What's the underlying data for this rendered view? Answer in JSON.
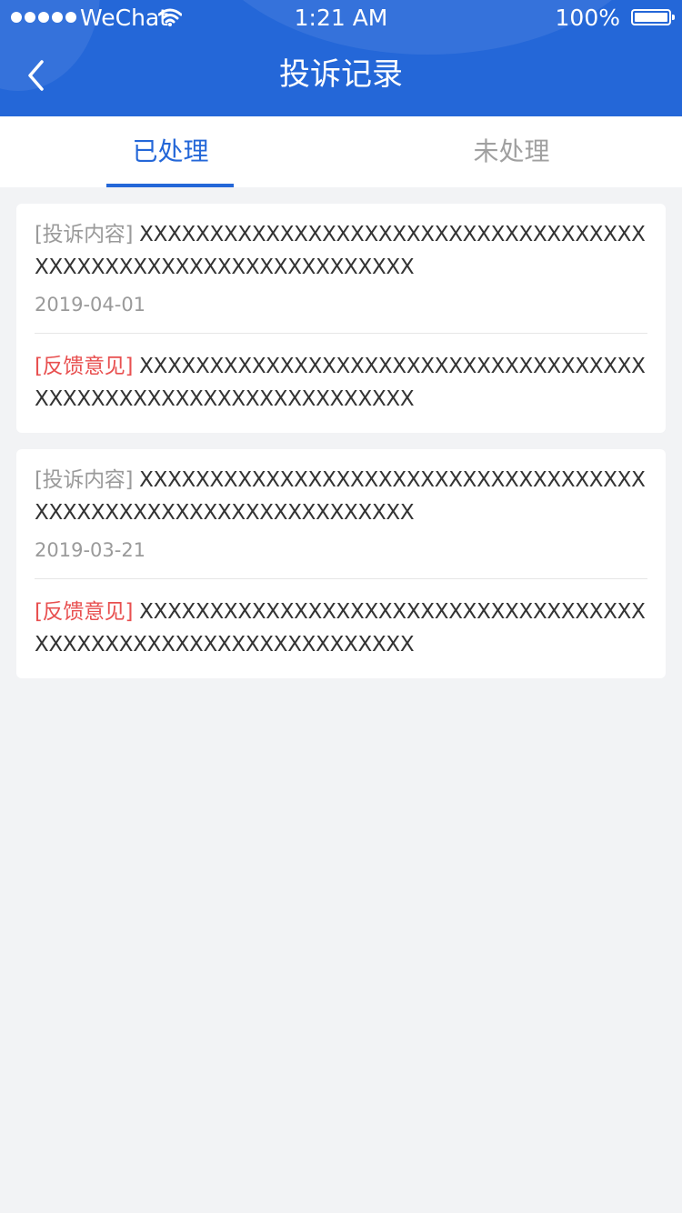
{
  "status_bar": {
    "carrier": "WeChat",
    "time": "1:21 AM",
    "battery": "100%"
  },
  "header": {
    "title": "投诉记录",
    "back_icon": "chevron-left-icon"
  },
  "tabs": [
    {
      "label": "已处理",
      "active": true
    },
    {
      "label": "未处理",
      "active": false
    }
  ],
  "colors": {
    "primary": "#2467d8",
    "feedback_label": "#e85050",
    "background": "#f2f3f5"
  },
  "records": [
    {
      "complaint_label": "[投诉内容]",
      "complaint_text": " XXXXXXXXXXXXXXXXXXXXXXXXXXXXXXXXXXXXXXXXXXXXXXXXXXXXXXXXXXXXXXX",
      "date": "2019-04-01",
      "feedback_label": "[反馈意见]",
      "feedback_text": " XXXXXXXXXXXXXXXXXXXXXXXXXXXXXXXXXXXXXXXXXXXXXXXXXXXXXXXXXXXXXXX"
    },
    {
      "complaint_label": "[投诉内容]",
      "complaint_text": " XXXXXXXXXXXXXXXXXXXXXXXXXXXXXXXXXXXXXXXXXXXXXXXXXXXXXXXXXXXXXXX",
      "date": "2019-03-21",
      "feedback_label": "[反馈意见]",
      "feedback_text": " XXXXXXXXXXXXXXXXXXXXXXXXXXXXXXXXXXXXXXXXXXXXXXXXXXXXXXXXXXXXXXX"
    }
  ]
}
